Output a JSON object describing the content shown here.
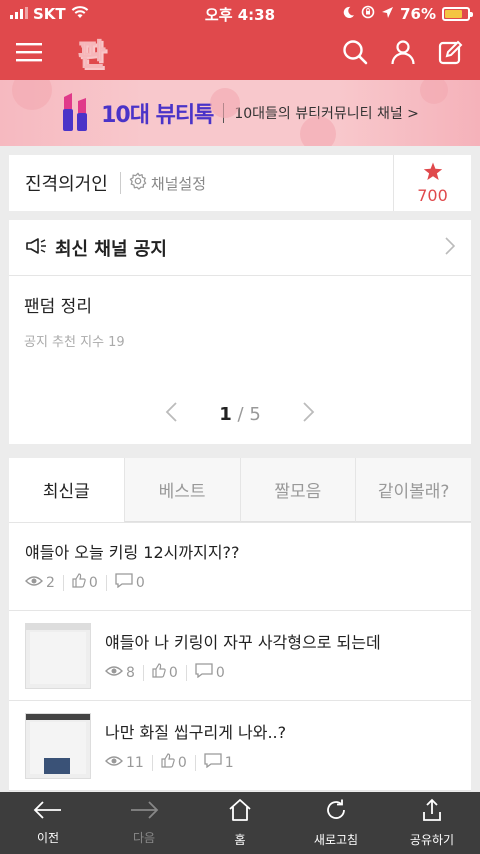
{
  "status": {
    "carrier": "SKT",
    "time": "오후 4:38",
    "battery": "76%",
    "battery_level": 0.76
  },
  "banner": {
    "title": "10대 뷰티톡",
    "desc": "10대들의 뷰티커뮤니티 채널 >"
  },
  "channel": {
    "name": "진격의거인",
    "settings_label": "채널설정",
    "star_count": "700"
  },
  "notice": {
    "heading": "최신 채널 공지",
    "title": "팬덤 정리",
    "meta": "공지 추천 지수 19",
    "page_current": "1",
    "page_sep": "/",
    "page_total": "5"
  },
  "tabs": [
    {
      "label": "최신글"
    },
    {
      "label": "베스트"
    },
    {
      "label": "짤모음"
    },
    {
      "label": "같이볼래?"
    }
  ],
  "posts": [
    {
      "title": "얘들아 오늘 키링 12시까지지??",
      "views": "2",
      "likes": "0",
      "comments": "0"
    },
    {
      "title": "얘들아 나 키링이 자꾸 사각형으로 되는데",
      "views": "8",
      "likes": "0",
      "comments": "0"
    },
    {
      "title": "나만 화질 씹구리게 나와..?",
      "views": "11",
      "likes": "0",
      "comments": "1"
    }
  ],
  "bottom_nav": {
    "back": "이전",
    "forward": "다음",
    "home": "홈",
    "refresh": "새로고침",
    "share": "공유하기"
  },
  "colors": {
    "brand": "#e0494c",
    "banner_title": "#4a33c8"
  }
}
